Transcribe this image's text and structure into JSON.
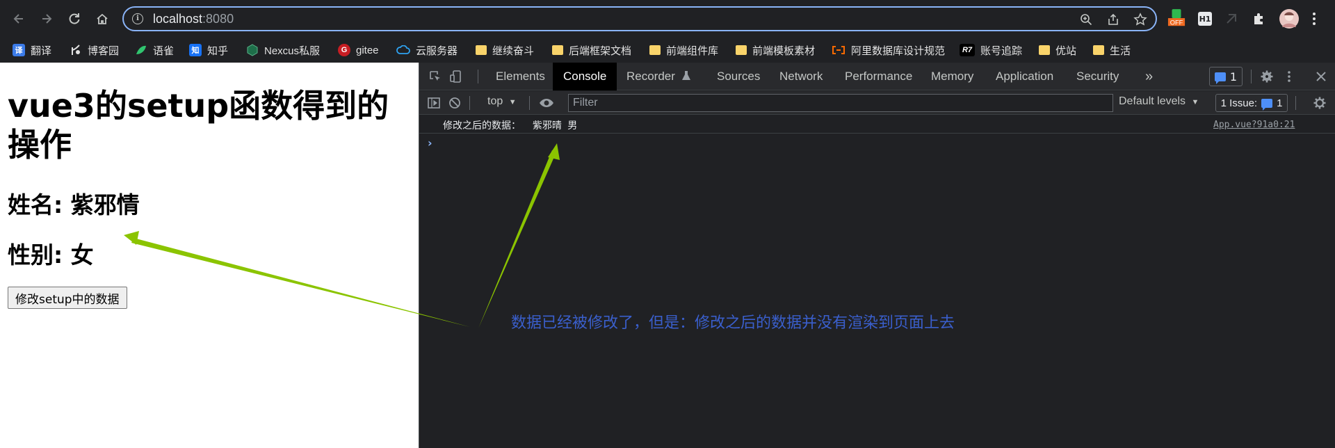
{
  "browser": {
    "url_host": "localhost",
    "url_port": ":8080",
    "bookmarks": [
      "翻译",
      "博客园",
      "语雀",
      "知乎",
      "Nexcus私服",
      "gitee",
      "云服务器",
      "继续奋斗",
      "后端框架文档",
      "前端组件库",
      "前端模板素材",
      "阿里数据库设计规范",
      "账号追踪",
      "优站",
      "生活"
    ],
    "bookmark_badge_text": [
      "译",
      "知",
      "G",
      "R7"
    ],
    "extension_off_label": "OFF",
    "ext_h1_label": "H1",
    "brand_color": "#8ab4f8"
  },
  "page": {
    "title": "vue3的setup函数得到的操作",
    "name_line": "姓名: 紫邪情",
    "gender_line": "性别: 女",
    "button_label": "修改setup中的数据"
  },
  "devtools": {
    "tabs": [
      "Elements",
      "Console",
      "Recorder",
      "Sources",
      "Network",
      "Performance",
      "Memory",
      "Application",
      "Security"
    ],
    "active_tab": "Console",
    "more_tabs": "»",
    "message_badge": "1",
    "context": "top",
    "filter_placeholder": "Filter",
    "levels": "Default levels",
    "issues_label": "1 Issue:",
    "issues_count": "1",
    "console_message": "修改之后的数据：  紫邪晴 男",
    "console_source": "App.vue?91a0:21",
    "prompt": "›"
  },
  "annotation": {
    "text": "数据已经被修改了，但是：修改之后的数据并没有渲染到页面上去",
    "arrow_color": "#8bc400"
  }
}
